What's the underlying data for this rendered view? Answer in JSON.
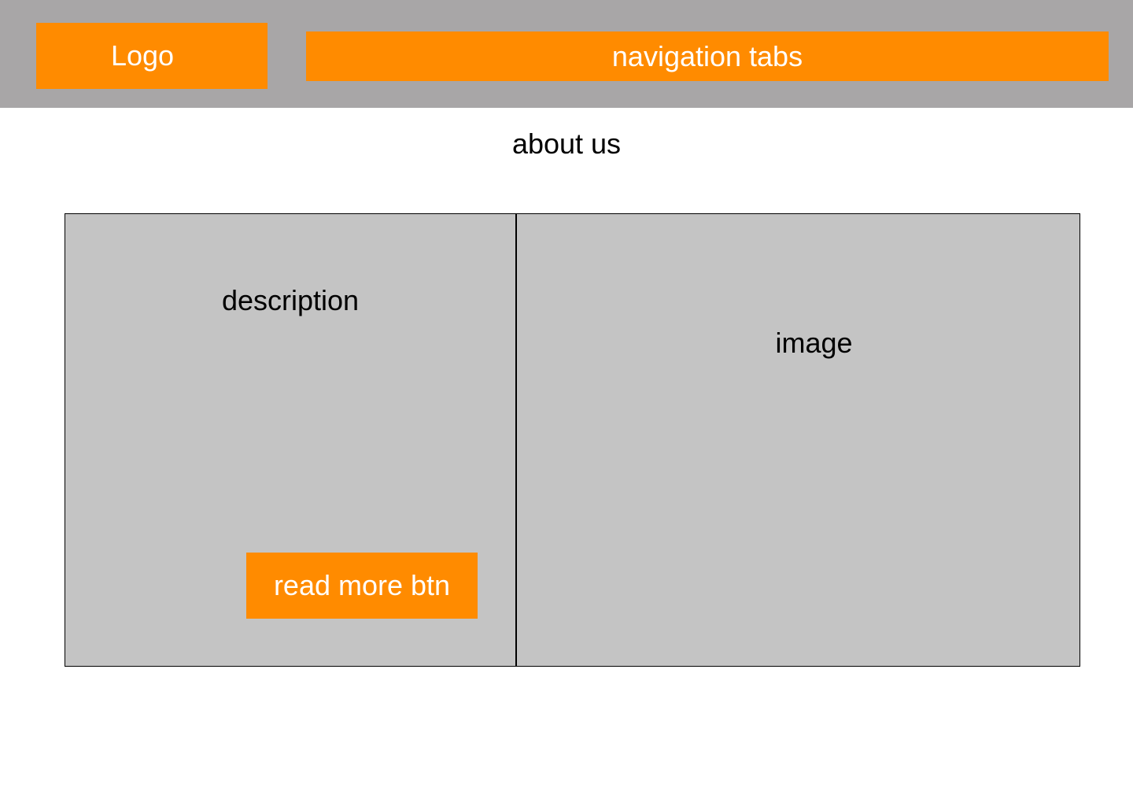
{
  "header": {
    "logo_label": "Logo",
    "nav_label": "navigation tabs"
  },
  "main": {
    "title": "about us",
    "description_label": "description",
    "read_more_label": "read more btn",
    "image_label": "image"
  },
  "colors": {
    "header_bg": "#a8a6a7",
    "accent": "#ff8b00",
    "panel_bg": "#c4c4c4",
    "page_bg": "#ffffff"
  }
}
